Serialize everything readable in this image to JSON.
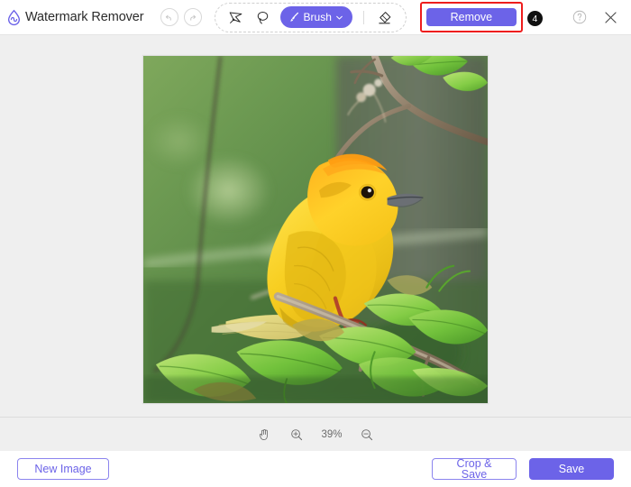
{
  "app": {
    "title": "Watermark Remover",
    "logo_icon": "water-drop-wave-logo",
    "accent_color": "#6C63E8",
    "highlight_color": "#ee1d1d",
    "badge_color": "#101010",
    "canvas_background": "#EFEFEF"
  },
  "topbar": {
    "undo_icon": "undo-arrow-icon",
    "redo_icon": "redo-arrow-icon",
    "tools": [
      {
        "name": "polygon-lasso-tool",
        "icon": "polygon-lasso-icon"
      },
      {
        "name": "lasso-tool",
        "icon": "lasso-icon"
      }
    ],
    "brush": {
      "label": "Brush",
      "icon": "paintbrush-icon",
      "chevron_icon": "chevron-down-icon"
    },
    "eraser": {
      "name": "eraser-tool",
      "icon": "eraser-icon"
    },
    "remove": {
      "label": "Remove",
      "badge": "4",
      "highlighted": "true"
    },
    "help_icon": "question-mark-circle-icon",
    "close_icon": "close-x-icon"
  },
  "canvas": {
    "image_alt": "yellow-weaver-bird-on-branch",
    "image_name": "bird-photo"
  },
  "zoombar": {
    "hand_icon": "hand-pan-icon",
    "zoom_in_icon": "zoom-in-magnifier-icon",
    "zoom_level": "39%",
    "zoom_out_icon": "zoom-out-magnifier-icon"
  },
  "footer": {
    "new_image_label": "New Image",
    "crop_save_label": "Crop & Save",
    "save_label": "Save"
  }
}
